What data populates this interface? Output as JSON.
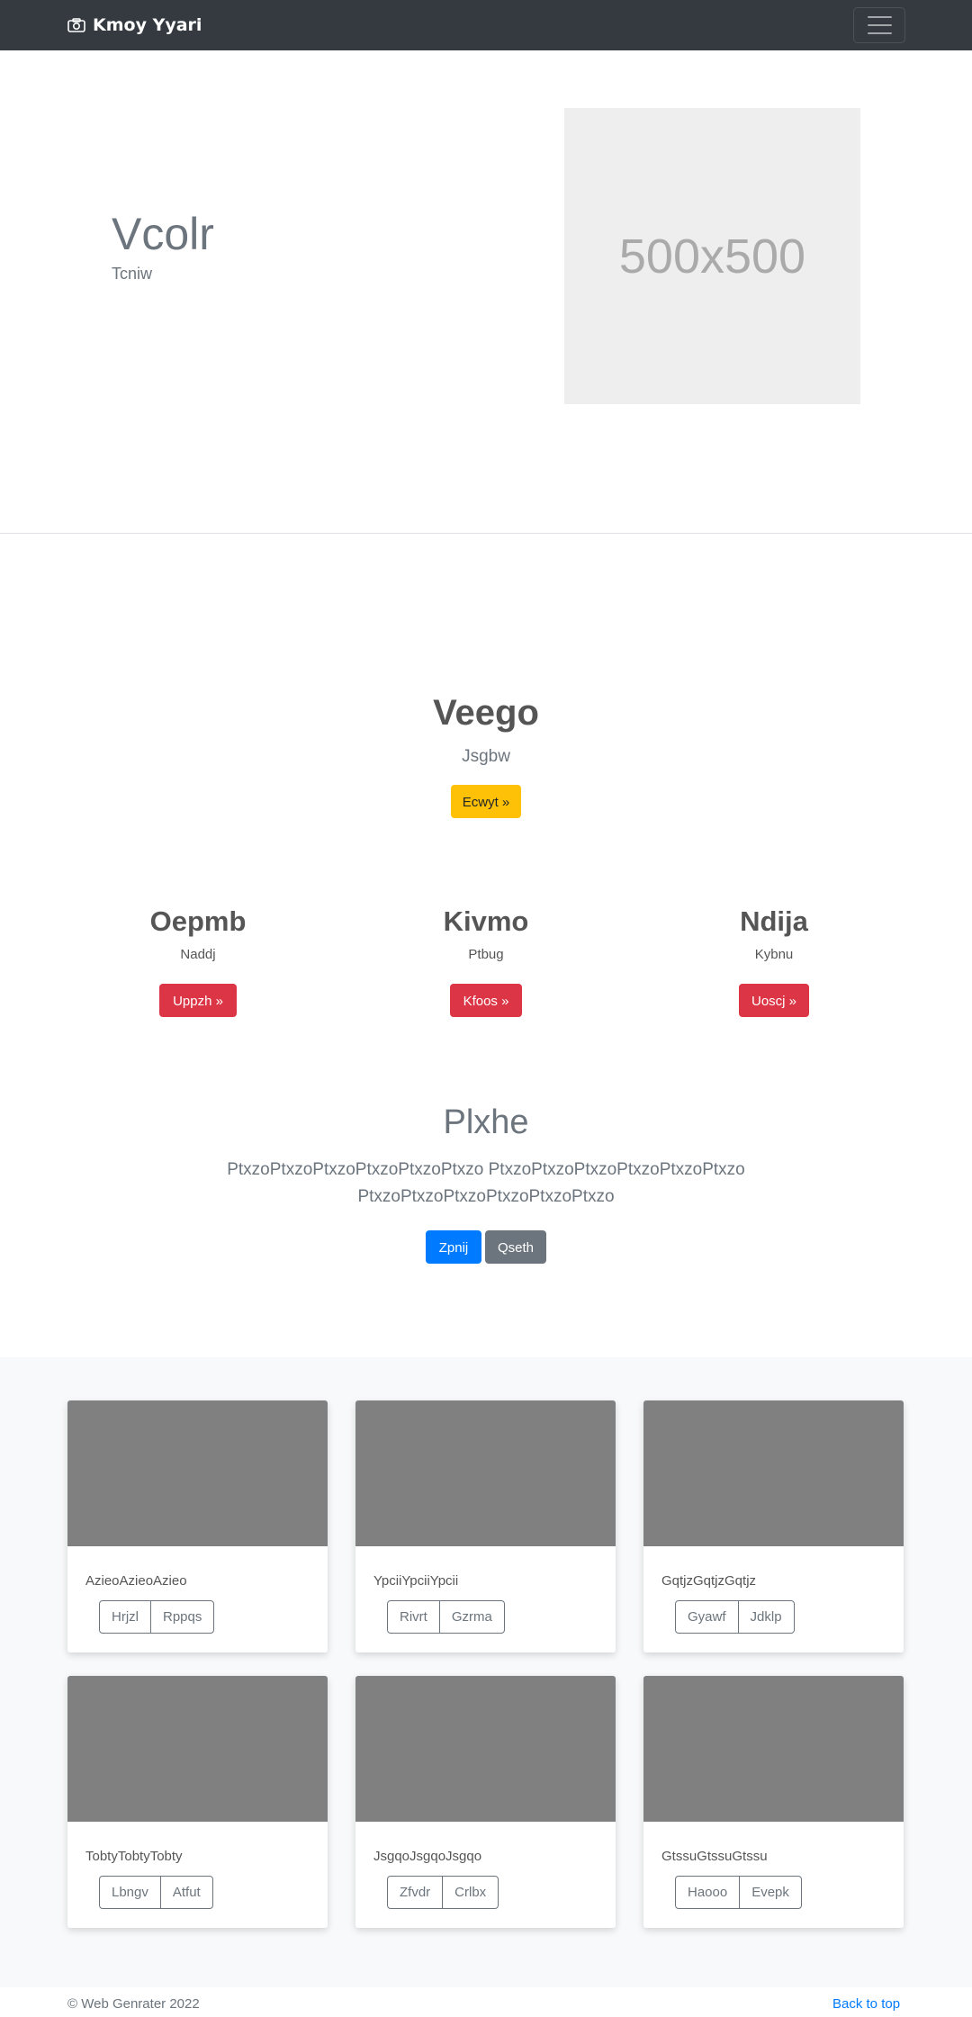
{
  "navbar": {
    "brand": "Kmoy Yyari",
    "brand_icon": "camera-icon",
    "toggler_icon": "hamburger-menu-icon"
  },
  "hero": {
    "title": "Vcolr",
    "subtitle": "Tcniw",
    "image_placeholder": "500x500"
  },
  "feature": {
    "title": "Veego",
    "subtitle": "Jsgbw",
    "button": "Ecwyt »"
  },
  "columns": [
    {
      "title": "Oepmb",
      "subtitle": "Naddj",
      "button": "Uppzh »"
    },
    {
      "title": "Kivmo",
      "subtitle": "Ptbug",
      "button": "Kfoos »"
    },
    {
      "title": "Ndija",
      "subtitle": "Kybnu",
      "button": "Uoscj »"
    }
  ],
  "jumbo": {
    "title": "Plxhe",
    "text": "PtxzoPtxzoPtxzoPtxzoPtxzoPtxzo PtxzoPtxzoPtxzoPtxzoPtxzoPtxzo PtxzoPtxzoPtxzoPtxzoPtxzoPtxzo",
    "primary_button": "Zpnij",
    "secondary_button": "Qseth"
  },
  "cards": [
    {
      "text": "AzieoAzieoAzieo",
      "btn1": "Hrjzl",
      "btn2": "Rppqs"
    },
    {
      "text": "YpciiYpciiYpcii",
      "btn1": "Rivrt",
      "btn2": "Gzrma"
    },
    {
      "text": "GqtjzGqtjzGqtjz",
      "btn1": "Gyawf",
      "btn2": "Jdklp"
    },
    {
      "text": "TobtyTobtyTobty",
      "btn1": "Lbngv",
      "btn2": "Atfut"
    },
    {
      "text": "JsgqoJsgqoJsgqo",
      "btn1": "Zfvdr",
      "btn2": "Crlbx"
    },
    {
      "text": "GtssuGtssuGtssu",
      "btn1": "Haooo",
      "btn2": "Evepk"
    }
  ],
  "footer": {
    "copyright": "© Web Genrater 2022",
    "back_to_top": "Back to top"
  },
  "colors": {
    "navbar": "#343a40",
    "warning": "#ffc107",
    "danger": "#dc3545",
    "primary": "#007bff",
    "secondary": "#6c757d",
    "album_bg": "#f8f9fa"
  }
}
